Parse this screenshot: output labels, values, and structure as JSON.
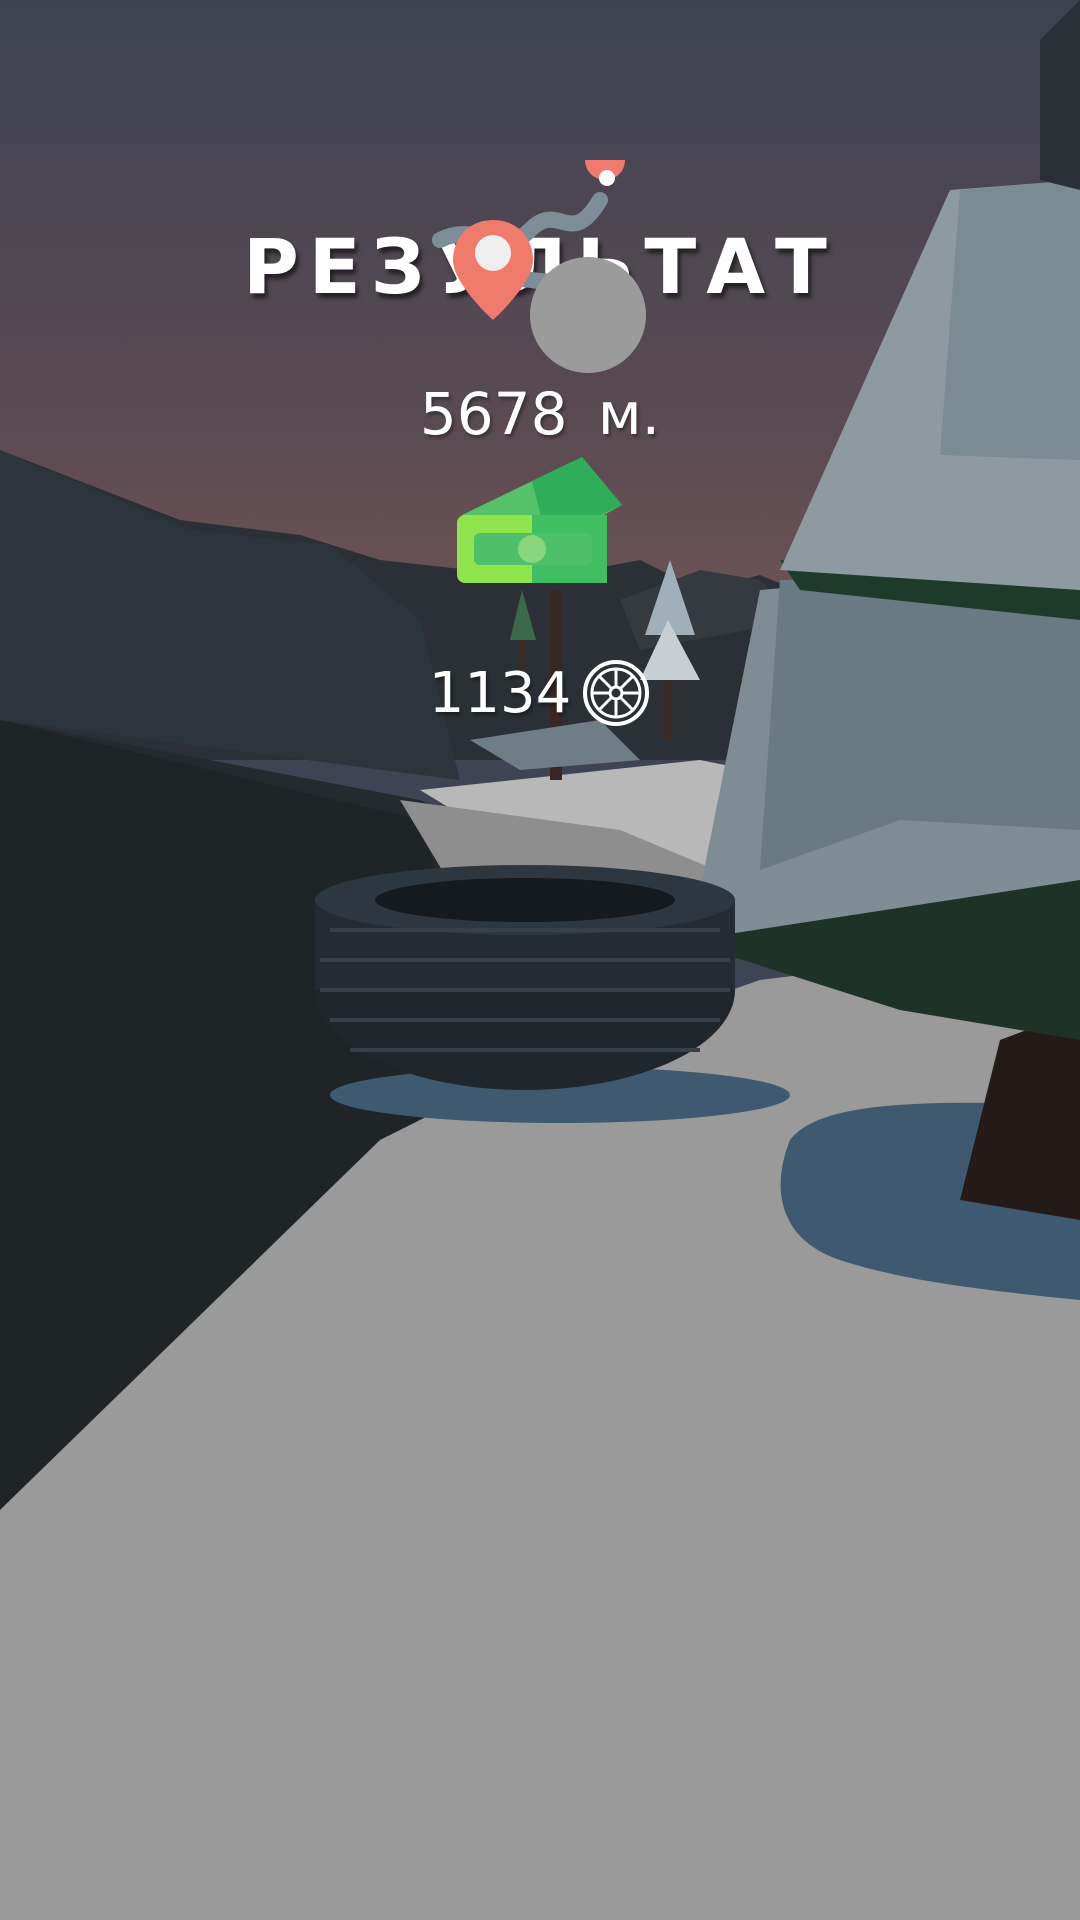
{
  "result": {
    "title": "РЕЗУЛЬТАТ",
    "distance": "5678 м.",
    "coins": "1134"
  },
  "icons": {
    "distance": "route-map-pin-icon",
    "money": "cash-money-icon",
    "coin": "wheel-rim-icon"
  },
  "colors": {
    "pin": "#f07a6c",
    "cash_light": "#8fe34c",
    "cash_dark": "#3fbf62",
    "text": "#ffffff"
  }
}
